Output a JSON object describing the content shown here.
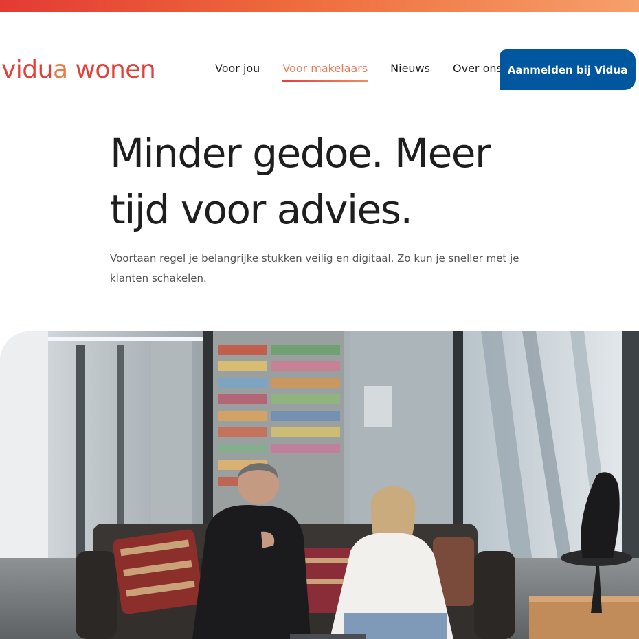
{
  "brand": {
    "logo_part_1": "vidu",
    "logo_part_2": "a",
    "logo_part_3": " wonen",
    "accent_red": "#e4403a",
    "accent_orange": "#f07a3e",
    "primary_blue": "#0057a0"
  },
  "nav": {
    "items": [
      {
        "label": "Voor jou",
        "active": false
      },
      {
        "label": "Voor makelaars",
        "active": true
      },
      {
        "label": "Nieuws",
        "active": false
      },
      {
        "label": "Over ons",
        "active": false
      }
    ],
    "cta_label": "Aanmelden bij Vidua"
  },
  "hero": {
    "title": "Minder gedoe. Meer tijd voor advies.",
    "subtitle": "Voortaan regel je belangrijke stukken veilig en digitaal. Zo kun je sneller met je klanten schakelen."
  }
}
